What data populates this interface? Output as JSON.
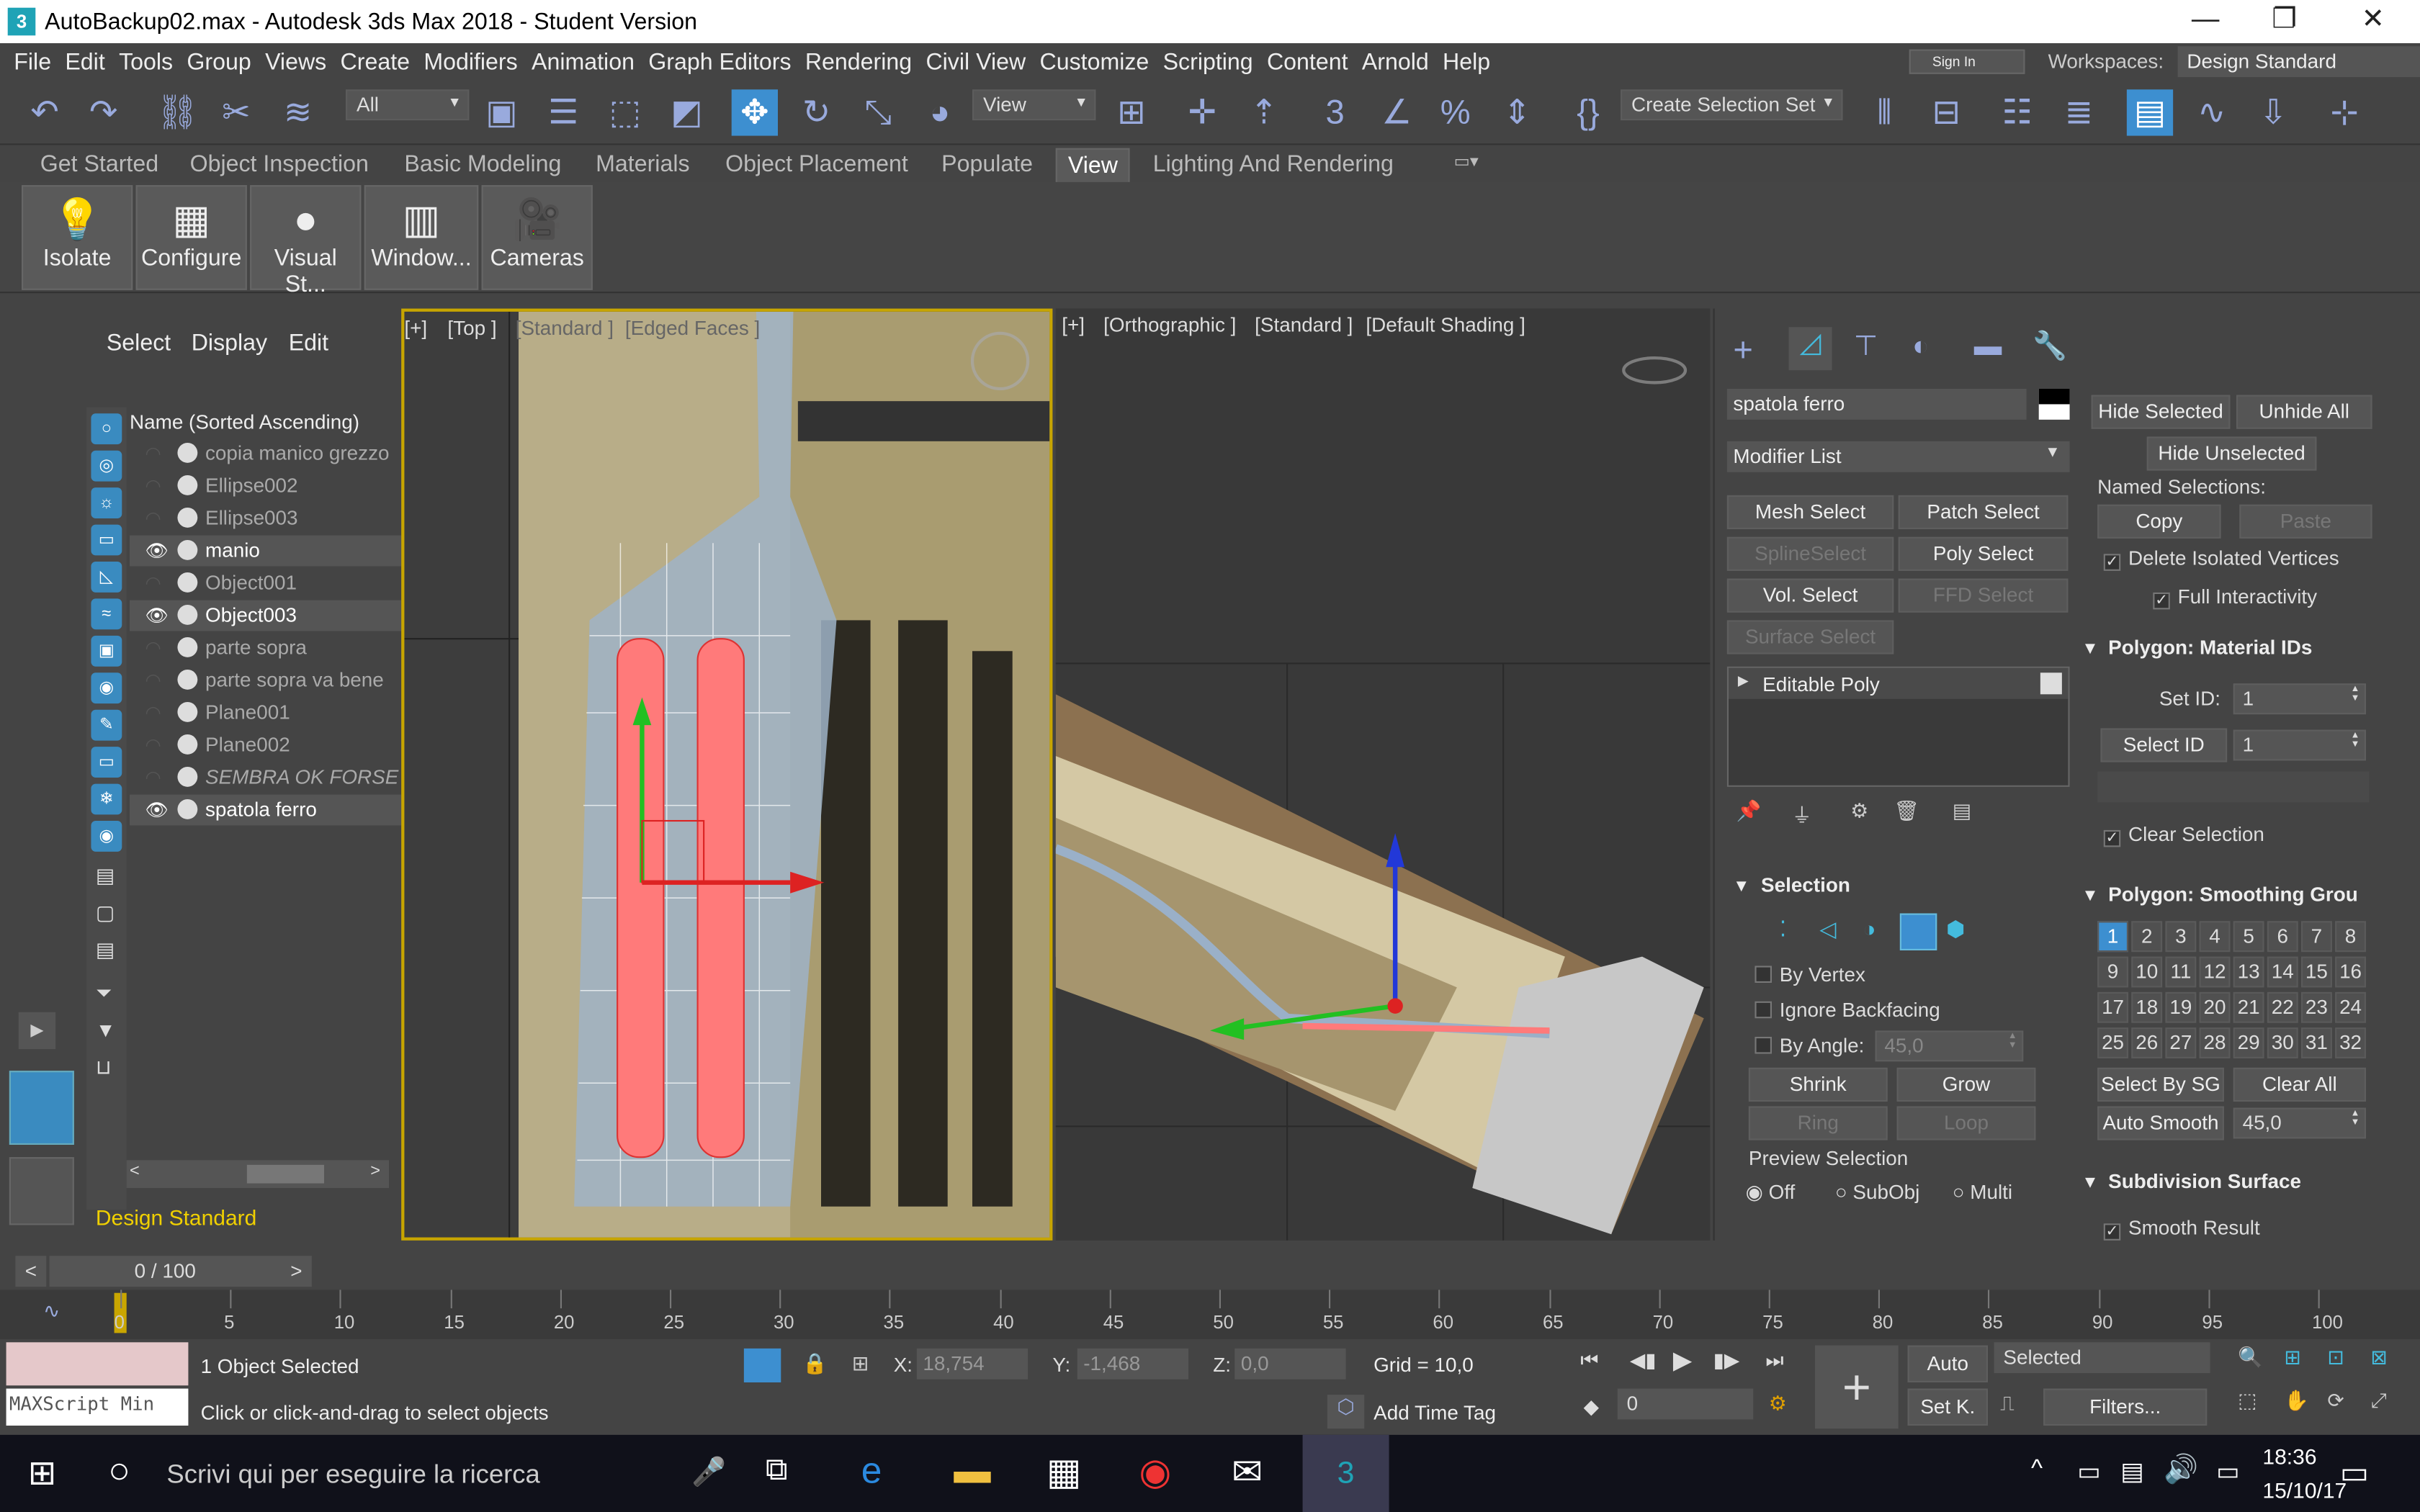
{
  "window": {
    "title": "AutoBackup02.max - Autodesk 3ds Max 2018 - Student Version",
    "app_icon": "3"
  },
  "menu": [
    "File",
    "Edit",
    "Tools",
    "Group",
    "Views",
    "Create",
    "Modifiers",
    "Animation",
    "Graph Editors",
    "Rendering",
    "Civil View",
    "Customize",
    "Scripting",
    "Content",
    "Arnold",
    "Help"
  ],
  "signin": "Sign In",
  "workspaces_label": "Workspaces:",
  "workspace_value": "Design Standard",
  "toolbar": {
    "filter": "All",
    "refcoord": "View",
    "selset": "Create Selection Set"
  },
  "ribbon_tabs": [
    "Get Started",
    "Object Inspection",
    "Basic Modeling",
    "Materials",
    "Object Placement",
    "Populate",
    "View",
    "Lighting And Rendering"
  ],
  "ribbon_buttons": [
    "Isolate",
    "Configure",
    "Visual St...",
    "Window...",
    "Cameras"
  ],
  "scene_explorer": {
    "menu": [
      "Select",
      "Display",
      "Edit"
    ],
    "header": "Name (Sorted Ascending)",
    "items": [
      {
        "name": "copia manico grezzo",
        "visible": false
      },
      {
        "name": "Ellipse002",
        "visible": false
      },
      {
        "name": "Ellipse003",
        "visible": false
      },
      {
        "name": "manio",
        "visible": true
      },
      {
        "name": "Object001",
        "visible": false
      },
      {
        "name": "Object003",
        "visible": true
      },
      {
        "name": "parte sopra",
        "visible": false
      },
      {
        "name": "parte sopra va bene",
        "visible": false
      },
      {
        "name": "Plane001",
        "visible": false
      },
      {
        "name": "Plane002",
        "visible": false
      },
      {
        "name": "SEMBRA OK FORSE",
        "visible": false
      },
      {
        "name": "spatola ferro",
        "visible": true
      }
    ],
    "workspace": "Design Standard"
  },
  "viewport_top": {
    "plus": "[+]",
    "view": "[Top ]",
    "shading": "[Standard ]",
    "edged": "[Edged Faces ]"
  },
  "viewport_ortho": {
    "plus": "[+]",
    "view": "[Orthographic ]",
    "shading": "[Standard ]",
    "mode": "[Default Shading ]"
  },
  "command_panel": {
    "object_name": "spatola ferro",
    "modifier_list": "Modifier List",
    "buttons": [
      "Mesh Select",
      "Patch Select",
      "SplineSelect",
      "Poly Select",
      "Vol. Select",
      "FFD Select",
      "Surface Select"
    ],
    "stack_item": "Editable Poly",
    "selection_title": "Selection",
    "by_vertex": "By Vertex",
    "ignore_backfacing": "Ignore Backfacing",
    "by_angle": "By Angle:",
    "by_angle_value": "45,0",
    "shrink": "Shrink",
    "grow": "Grow",
    "ring": "Ring",
    "loop": "Loop",
    "preview_selection": "Preview Selection",
    "preview_off": "Off",
    "preview_subobj": "SubObj",
    "preview_multi": "Multi",
    "hide_selected": "Hide Selected",
    "unhide_all": "Unhide All",
    "hide_unselected": "Hide Unselected",
    "named_selections": "Named Selections:",
    "copy": "Copy",
    "paste": "Paste",
    "delete_isolated": "Delete Isolated Vertices",
    "full_interactivity": "Full Interactivity",
    "matid_title": "Polygon: Material IDs",
    "set_id_label": "Set ID:",
    "set_id_value": "1",
    "select_id": "Select ID",
    "select_id_value": "1",
    "clear_selection": "Clear Selection",
    "smoothing_title": "Polygon: Smoothing Grou",
    "sg_numbers": [
      "1",
      "2",
      "3",
      "4",
      "5",
      "6",
      "7",
      "8",
      "9",
      "10",
      "11",
      "12",
      "13",
      "14",
      "15",
      "16",
      "17",
      "18",
      "19",
      "20",
      "21",
      "22",
      "23",
      "24",
      "25",
      "26",
      "27",
      "28",
      "29",
      "30",
      "31",
      "32"
    ],
    "select_by_sg": "Select By SG",
    "clear_all": "Clear All",
    "auto_smooth": "Auto Smooth",
    "auto_smooth_value": "45,0",
    "subdiv_title": "Subdivision Surface",
    "smooth_result": "Smooth Result"
  },
  "timeline": {
    "frame": "0 / 100",
    "ticks": [
      "0",
      "5",
      "10",
      "15",
      "20",
      "25",
      "30",
      "35",
      "40",
      "45",
      "50",
      "55",
      "60",
      "65",
      "70",
      "75",
      "80",
      "85",
      "90",
      "95",
      "100"
    ]
  },
  "status": {
    "maxscript": "MAXScript Min",
    "selected": "1 Object Selected",
    "prompt": "Click or click-and-drag to select objects",
    "x_label": "X:",
    "x_value": "18,754",
    "y_label": "Y:",
    "y_value": "-1,468",
    "z_label": "Z:",
    "z_value": "0,0",
    "grid": "Grid = 10,0",
    "add_time_tag": "Add Time Tag",
    "auto": "Auto",
    "setk": "Set K.",
    "key_filter": "Selected",
    "filters": "Filters...",
    "frame_value": "0"
  },
  "taskbar": {
    "search": "Scrivi qui per eseguire la ricerca",
    "time": "18:36",
    "date": "15/10/17"
  }
}
